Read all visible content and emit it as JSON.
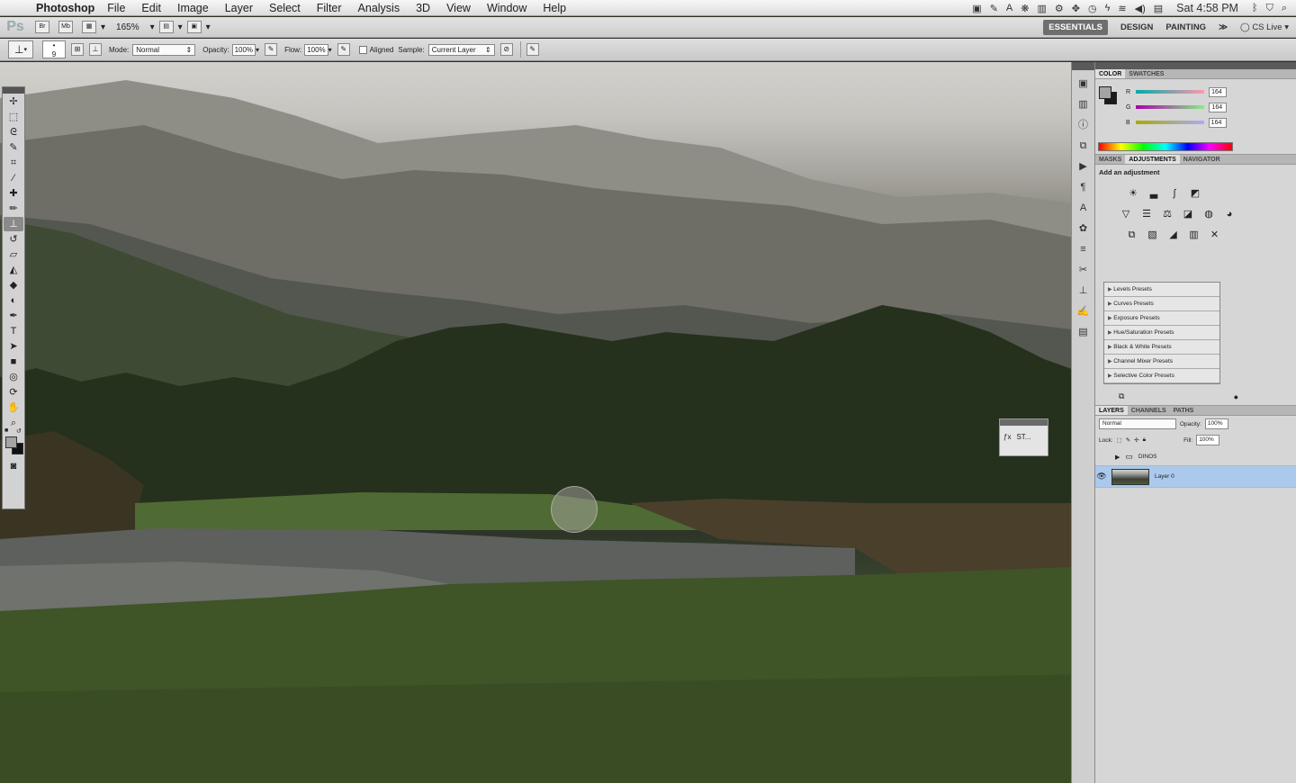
{
  "menubar": {
    "app_name": "Photoshop",
    "menus": [
      "File",
      "Edit",
      "Image",
      "Layer",
      "Select",
      "Filter",
      "Analysis",
      "3D",
      "View",
      "Window",
      "Help"
    ],
    "clock": "Sat 4:58 PM"
  },
  "appbar": {
    "logo": "Ps",
    "bridge": "Br",
    "minibridge": "Mb",
    "zoom": "165%",
    "workspaces": [
      "ESSENTIALS",
      "DESIGN",
      "PAINTING"
    ],
    "cs_live": "CS Live"
  },
  "options": {
    "brush_size": "9",
    "mode_label": "Mode:",
    "mode_value": "Normal",
    "opacity_label": "Opacity:",
    "opacity_value": "100%",
    "flow_label": "Flow:",
    "flow_value": "100%",
    "aligned_label": "Aligned",
    "sample_label": "Sample:",
    "sample_value": "Current Layer"
  },
  "mini_panel": {
    "label": "ST..."
  },
  "color_panel": {
    "tabs": [
      "COLOR",
      "SWATCHES"
    ],
    "r_label": "R",
    "r": "164",
    "g_label": "G",
    "g": "164",
    "b_label": "B",
    "b": "164"
  },
  "adjustments_panel": {
    "tabs": [
      "MASKS",
      "ADJUSTMENTS",
      "NAVIGATOR"
    ],
    "title": "Add an adjustment",
    "presets": [
      "Levels Presets",
      "Curves Presets",
      "Exposure Presets",
      "Hue/Saturation Presets",
      "Black & White Presets",
      "Channel Mixer Presets",
      "Selective Color Presets"
    ]
  },
  "layers_panel": {
    "tabs": [
      "LAYERS",
      "CHANNELS",
      "PATHS"
    ],
    "blend_mode": "Normal",
    "opacity_label": "Opacity:",
    "opacity": "100%",
    "lock_label": "Lock:",
    "fill_label": "Fill:",
    "fill": "100%",
    "group_name": "DINOS",
    "layer_name": "Layer 0"
  },
  "colors": {
    "selection": "#aac9ec",
    "foreground": "#a4a4a4",
    "background": "#1a1a1a"
  }
}
